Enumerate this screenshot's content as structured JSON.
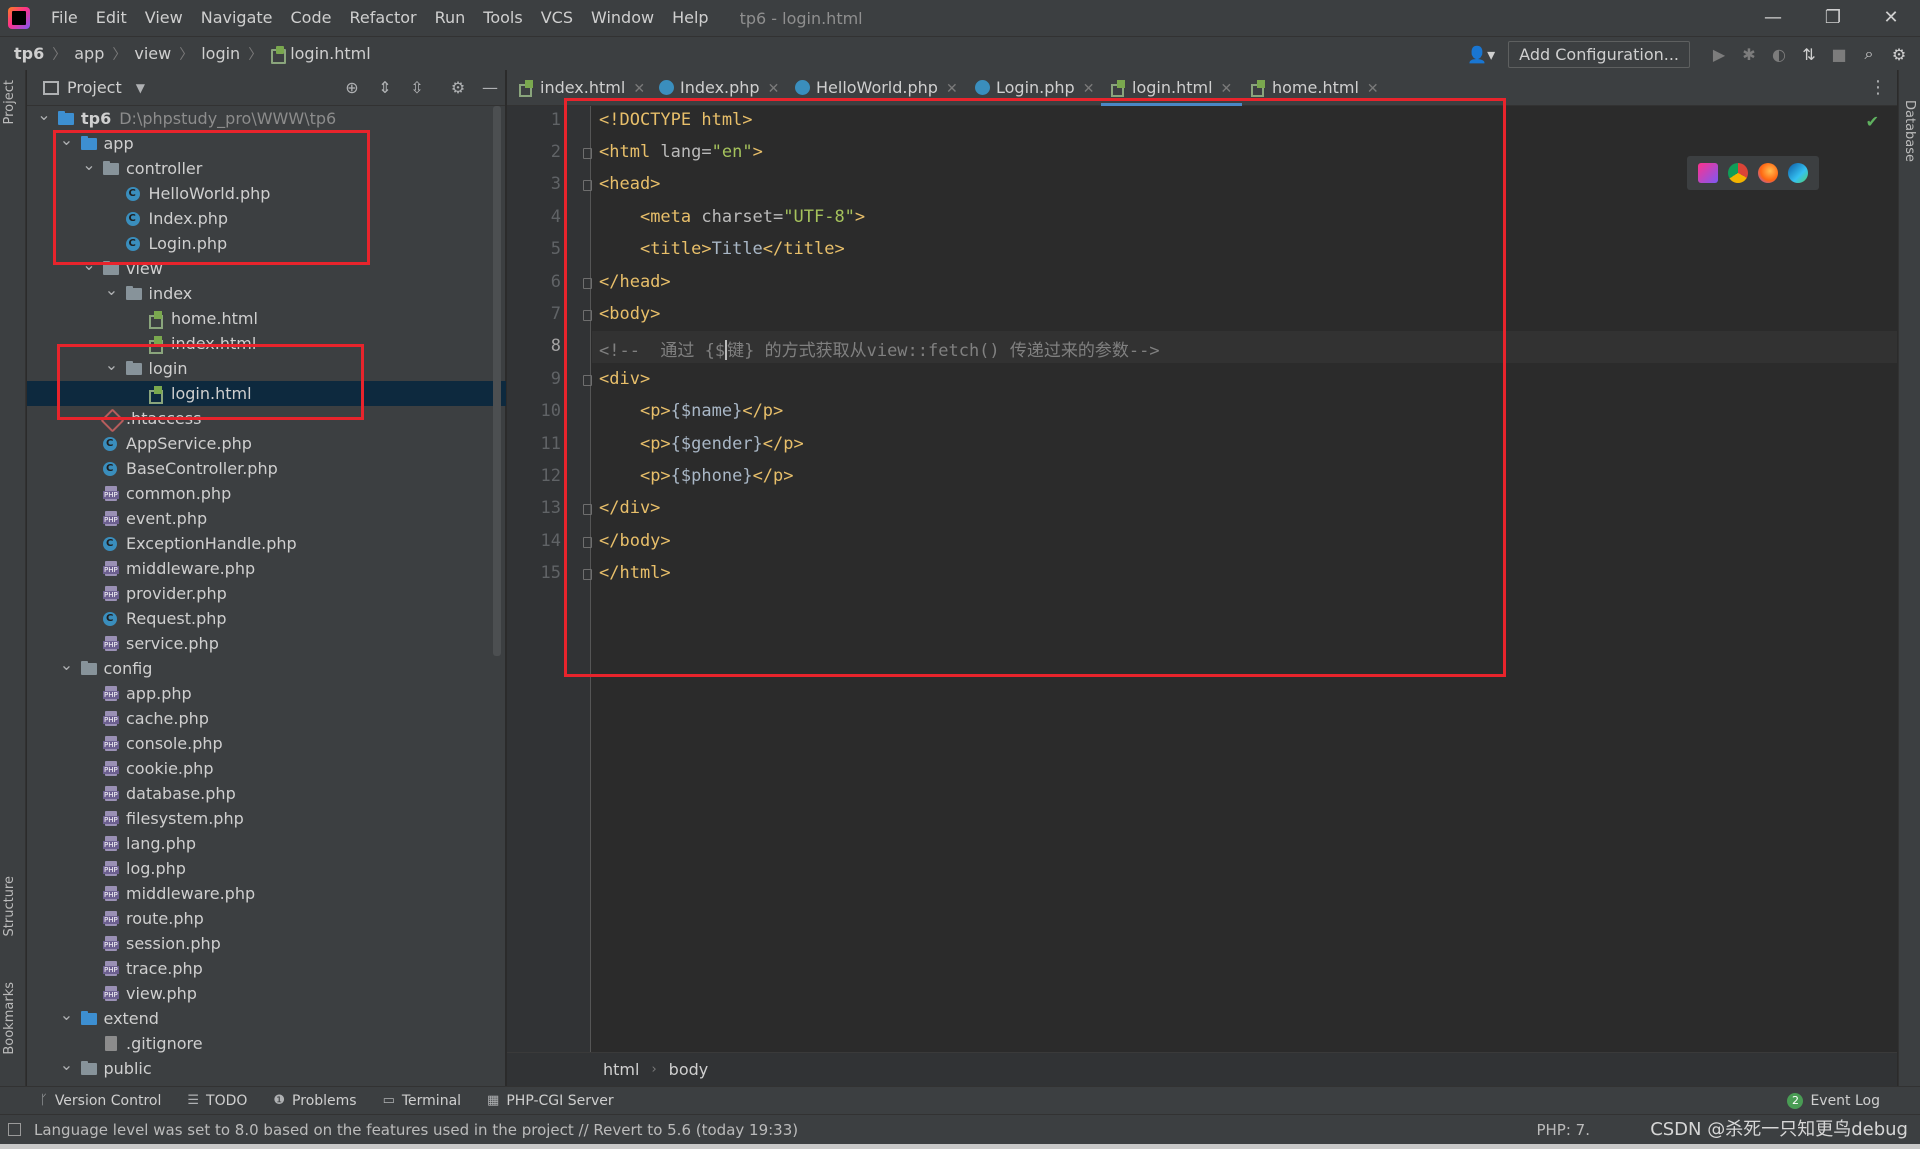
{
  "window": {
    "menus": [
      "File",
      "Edit",
      "View",
      "Navigate",
      "Code",
      "Refactor",
      "Run",
      "Tools",
      "VCS",
      "Window",
      "Help"
    ],
    "title": "tp6 - login.html",
    "minimize": "—",
    "restore": "❐",
    "close": "✕"
  },
  "navbar": {
    "crumbs": [
      "tp6",
      "app",
      "view",
      "login",
      "login.html"
    ],
    "add_configuration": "Add Configuration..."
  },
  "left_stripe": {
    "project": "Project",
    "structure": "Structure",
    "bookmarks": "Bookmarks"
  },
  "right_stripe": {
    "database": "Database"
  },
  "project_panel": {
    "title": "Project",
    "tree": [
      {
        "label": "tp6",
        "path": "D:\\phpstudy_pro\\WWW\\tp6"
      },
      {
        "label": "app"
      },
      {
        "label": "controller"
      },
      {
        "label": "HelloWorld.php"
      },
      {
        "label": "Index.php"
      },
      {
        "label": "Login.php"
      },
      {
        "label": "view"
      },
      {
        "label": "index"
      },
      {
        "label": "home.html"
      },
      {
        "label": "index.html"
      },
      {
        "label": "login"
      },
      {
        "label": "login.html"
      },
      {
        "label": ".htaccess"
      },
      {
        "label": "AppService.php"
      },
      {
        "label": "BaseController.php"
      },
      {
        "label": "common.php"
      },
      {
        "label": "event.php"
      },
      {
        "label": "ExceptionHandle.php"
      },
      {
        "label": "middleware.php"
      },
      {
        "label": "provider.php"
      },
      {
        "label": "Request.php"
      },
      {
        "label": "service.php"
      },
      {
        "label": "config"
      },
      {
        "label": "app.php"
      },
      {
        "label": "cache.php"
      },
      {
        "label": "console.php"
      },
      {
        "label": "cookie.php"
      },
      {
        "label": "database.php"
      },
      {
        "label": "filesystem.php"
      },
      {
        "label": "lang.php"
      },
      {
        "label": "log.php"
      },
      {
        "label": "middleware.php"
      },
      {
        "label": "route.php"
      },
      {
        "label": "session.php"
      },
      {
        "label": "trace.php"
      },
      {
        "label": "view.php"
      },
      {
        "label": "extend"
      },
      {
        "label": ".gitignore"
      },
      {
        "label": "public"
      }
    ]
  },
  "tabs": [
    "index.html",
    "Index.php",
    "HelloWorld.php",
    "Login.php",
    "login.html",
    "home.html"
  ],
  "editor": {
    "line_numbers": [
      "1",
      "2",
      "3",
      "4",
      "5",
      "6",
      "7",
      "8",
      "9",
      "10",
      "11",
      "12",
      "13",
      "14",
      "15"
    ],
    "code": {
      "l1": "<!DOCTYPE html>",
      "l2_tag_open": "<html ",
      "l2_attr": "lang=",
      "l2_val": "\"en\"",
      "l2_close": ">",
      "l3": "<head>",
      "l4_tag_open": "<meta ",
      "l4_attr": "charset=",
      "l4_val": "\"UTF-8\"",
      "l4_close": ">",
      "l5_open": "<title>",
      "l5_text": "Title",
      "l5_close": "</title>",
      "l6": "</head>",
      "l7": "<body>",
      "l8_a": "<!--  通过 {$",
      "l8_b": "键} 的方式获取从view::fetch() 传递过来的参数-->",
      "l9": "<div>",
      "l10_open": "<p>",
      "l10_text": "{$name}",
      "l10_close": "</p>",
      "l11_open": "<p>",
      "l11_text": "{$gender}",
      "l11_close": "</p>",
      "l12_open": "<p>",
      "l12_text": "{$phone}",
      "l12_close": "</p>",
      "l13": "</div>",
      "l14": "</body>",
      "l15": "</html>"
    },
    "breadcrumb": [
      "html",
      "body"
    ]
  },
  "bottom_tools": [
    "Version Control",
    "TODO",
    "Problems",
    "Terminal",
    "PHP-CGI Server"
  ],
  "event_log": {
    "count": "2",
    "label": "Event Log"
  },
  "status": {
    "message": "Language level was set to 8.0 based on the features used in the project // Revert to 5.6 (today 19:33)",
    "right": "PHP: 7.",
    "watermark": "CSDN @杀死一只知更鸟debug"
  }
}
